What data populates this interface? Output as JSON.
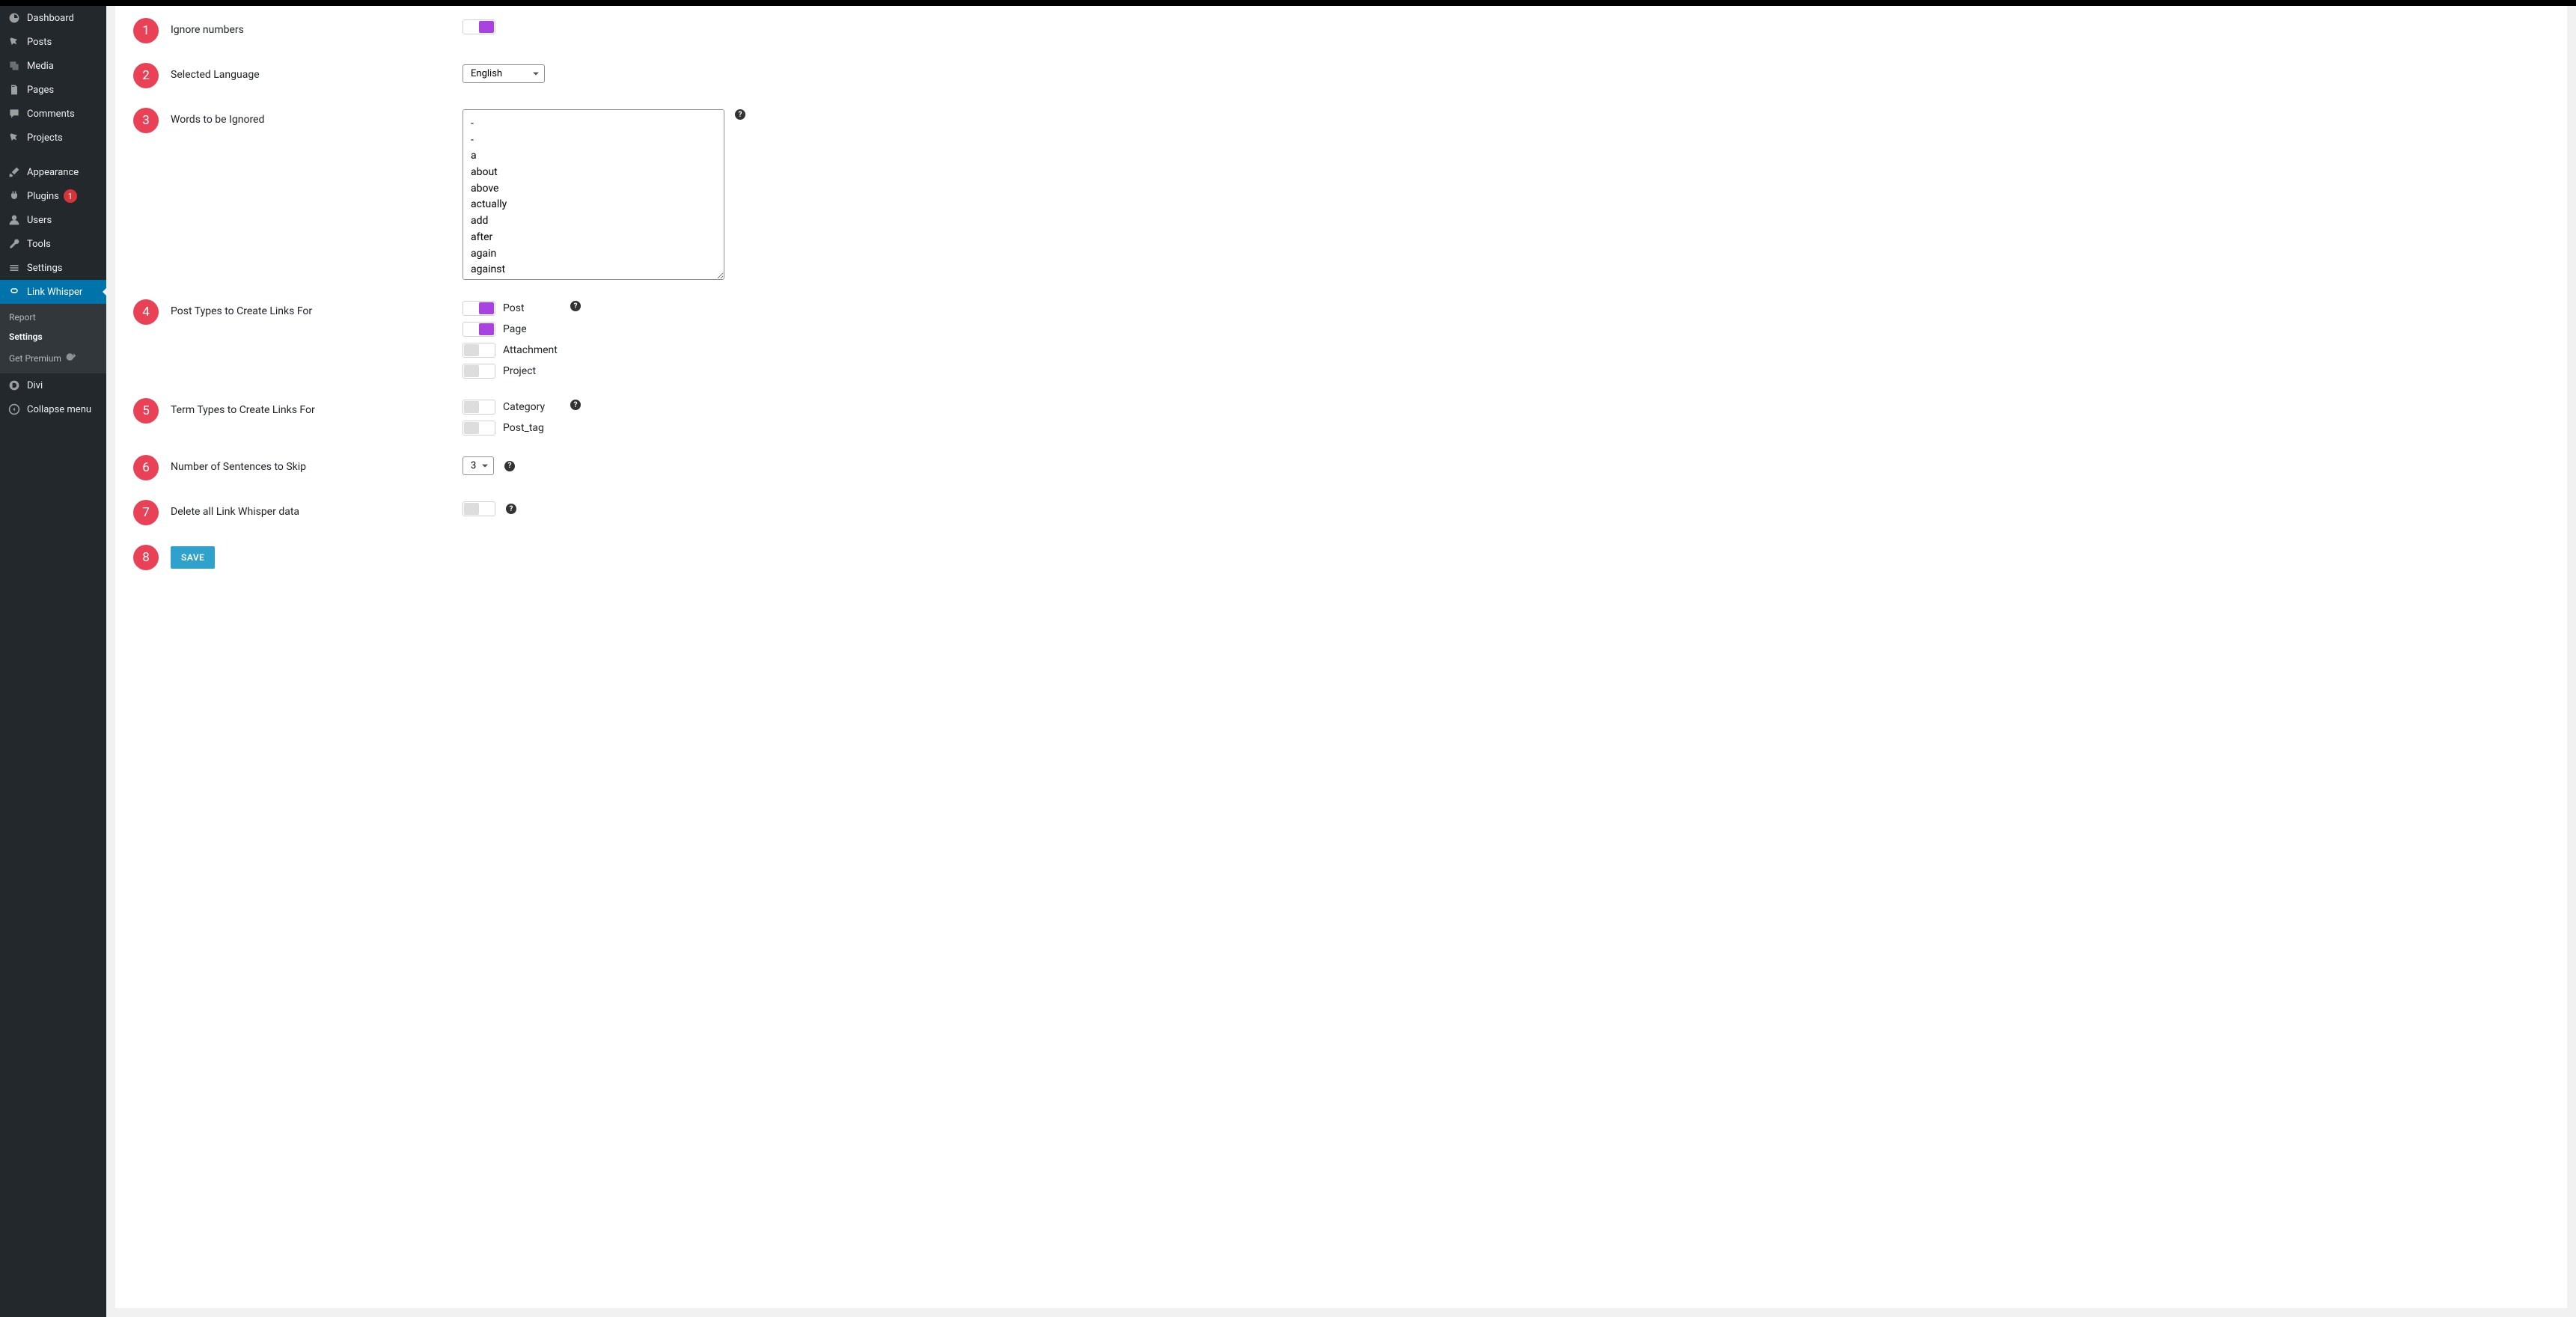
{
  "sidebar": {
    "items": [
      {
        "label": "Dashboard",
        "icon": "dashboard"
      },
      {
        "label": "Posts",
        "icon": "pin"
      },
      {
        "label": "Media",
        "icon": "media"
      },
      {
        "label": "Pages",
        "icon": "pages"
      },
      {
        "label": "Comments",
        "icon": "comment"
      },
      {
        "label": "Projects",
        "icon": "pin"
      }
    ],
    "items2": [
      {
        "label": "Appearance",
        "icon": "brush"
      },
      {
        "label": "Plugins",
        "icon": "plug",
        "badge": "1"
      },
      {
        "label": "Users",
        "icon": "user"
      },
      {
        "label": "Tools",
        "icon": "wrench"
      },
      {
        "label": "Settings",
        "icon": "sliders"
      }
    ],
    "active": {
      "label": "Link Whisper",
      "icon": "link"
    },
    "submenu": [
      {
        "label": "Report"
      },
      {
        "label": "Settings",
        "current": true
      },
      {
        "label": "Get Premium",
        "icon": "link-out"
      }
    ],
    "items3": [
      {
        "label": "Divi",
        "icon": "divi"
      },
      {
        "label": "Collapse menu",
        "icon": "collapse"
      }
    ]
  },
  "settings": {
    "rows": [
      {
        "n": "1",
        "label": "Ignore numbers"
      },
      {
        "n": "2",
        "label": "Selected Language",
        "language": "English"
      },
      {
        "n": "3",
        "label": "Words to be Ignored",
        "words": "-\n-\na\nabout\nabove\nactually\nadd\nafter\nagain\nagainst"
      },
      {
        "n": "4",
        "label": "Post Types to Create Links For",
        "types": [
          {
            "label": "Post",
            "on": true
          },
          {
            "label": "Page",
            "on": true
          },
          {
            "label": "Attachment",
            "on": false
          },
          {
            "label": "Project",
            "on": false
          }
        ]
      },
      {
        "n": "5",
        "label": "Term Types to Create Links For",
        "types": [
          {
            "label": "Category",
            "on": false
          },
          {
            "label": "Post_tag",
            "on": false
          }
        ]
      },
      {
        "n": "6",
        "label": "Number of Sentences to Skip",
        "value": "3"
      },
      {
        "n": "7",
        "label": "Delete all Link Whisper data"
      },
      {
        "n": "8",
        "save": "SAVE"
      }
    ]
  }
}
